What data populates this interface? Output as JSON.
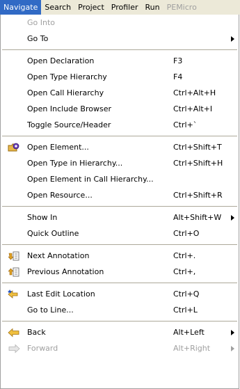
{
  "menubar": {
    "items": [
      {
        "label": "Navigate"
      },
      {
        "label": "Search"
      },
      {
        "label": "Project"
      },
      {
        "label": "Profiler"
      },
      {
        "label": "Run"
      },
      {
        "label": "PEMicro"
      }
    ]
  },
  "menu": {
    "go_into": {
      "label": "Go Into"
    },
    "go_to": {
      "label": "Go To"
    },
    "open_declaration": {
      "label": "Open Declaration",
      "shortcut": "F3"
    },
    "open_type_hierarchy": {
      "label": "Open Type Hierarchy",
      "shortcut": "F4"
    },
    "open_call_hierarchy": {
      "label": "Open Call Hierarchy",
      "shortcut": "Ctrl+Alt+H"
    },
    "open_include_browser": {
      "label": "Open Include Browser",
      "shortcut": "Ctrl+Alt+I"
    },
    "toggle_source_header": {
      "label": "Toggle Source/Header",
      "shortcut": "Ctrl+`"
    },
    "open_element": {
      "label": "Open Element...",
      "shortcut": "Ctrl+Shift+T"
    },
    "open_type_in_hierarchy": {
      "label": "Open Type in Hierarchy...",
      "shortcut": "Ctrl+Shift+H"
    },
    "open_element_in_call_hierarchy": {
      "label": "Open Element in Call Hierarchy..."
    },
    "open_resource": {
      "label": "Open Resource...",
      "shortcut": "Ctrl+Shift+R"
    },
    "show_in": {
      "label": "Show In",
      "shortcut": "Alt+Shift+W"
    },
    "quick_outline": {
      "label": "Quick Outline",
      "shortcut": "Ctrl+O"
    },
    "next_annotation": {
      "label": "Next Annotation",
      "shortcut": "Ctrl+."
    },
    "previous_annotation": {
      "label": "Previous Annotation",
      "shortcut": "Ctrl+,"
    },
    "last_edit_location": {
      "label": "Last Edit Location",
      "shortcut": "Ctrl+Q"
    },
    "go_to_line": {
      "label": "Go to Line...",
      "shortcut": "Ctrl+L"
    },
    "back": {
      "label": "Back",
      "shortcut": "Alt+Left"
    },
    "forward": {
      "label": "Forward",
      "shortcut": "Alt+Right"
    }
  },
  "colors": {
    "menubar_bg": "#ece9d8",
    "active_menu_bg": "#316ac5",
    "disabled_text": "#a0a0a0",
    "separator": "#aca899"
  },
  "icons": {
    "open_element": "open-element-icon",
    "next_annotation": "next-annotation-icon",
    "previous_annotation": "previous-annotation-icon",
    "last_edit_location": "last-edit-location-icon",
    "back": "back-arrow-icon",
    "forward": "forward-arrow-icon",
    "submenu": "submenu-arrow-icon"
  }
}
